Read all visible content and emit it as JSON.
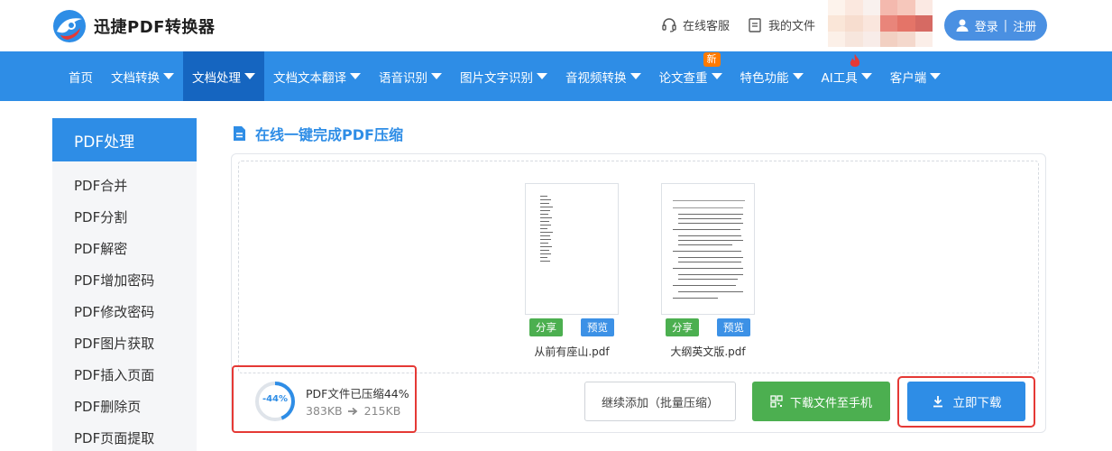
{
  "header": {
    "app_name": "迅捷PDF转换器",
    "online_service": "在线客服",
    "my_files": "我的文件",
    "login": "登录",
    "separator": "|",
    "register": "注册"
  },
  "nav": {
    "items": [
      {
        "label": "首页"
      },
      {
        "label": "文档转换"
      },
      {
        "label": "文档处理"
      },
      {
        "label": "文档文本翻译"
      },
      {
        "label": "语音识别"
      },
      {
        "label": "图片文字识别"
      },
      {
        "label": "音视频转换"
      },
      {
        "label": "论文查重"
      },
      {
        "label": "特色功能"
      },
      {
        "label": "AI工具"
      },
      {
        "label": "客户端"
      }
    ],
    "new_badge": "新"
  },
  "sidebar": {
    "title": "PDF处理",
    "items": [
      {
        "label": "PDF合并"
      },
      {
        "label": "PDF分割"
      },
      {
        "label": "PDF解密"
      },
      {
        "label": "PDF增加密码"
      },
      {
        "label": "PDF修改密码"
      },
      {
        "label": "PDF图片获取"
      },
      {
        "label": "PDF插入页面"
      },
      {
        "label": "PDF删除页"
      },
      {
        "label": "PDF页面提取"
      }
    ]
  },
  "main": {
    "title": "在线一键完成PDF压缩",
    "files": [
      {
        "name": "从前有座山.pdf",
        "share": "分享",
        "preview": "预览"
      },
      {
        "name": "大纲英文版.pdf",
        "share": "分享",
        "preview": "预览"
      }
    ],
    "status": {
      "ring_label": "-44%",
      "percent": 44,
      "title": "PDF文件已压缩44%",
      "from_size": "383KB",
      "to_size": "215KB"
    },
    "batch_add": "继续添加（批量压缩）",
    "download_to_phone": "下载文件至手机",
    "download_now": "立即下载"
  },
  "colors": {
    "primary": "#2e8de6",
    "nav_active": "#1565c0",
    "green": "#4caf50",
    "highlight_red": "#e53935",
    "badge_orange": "#ff7a00"
  }
}
